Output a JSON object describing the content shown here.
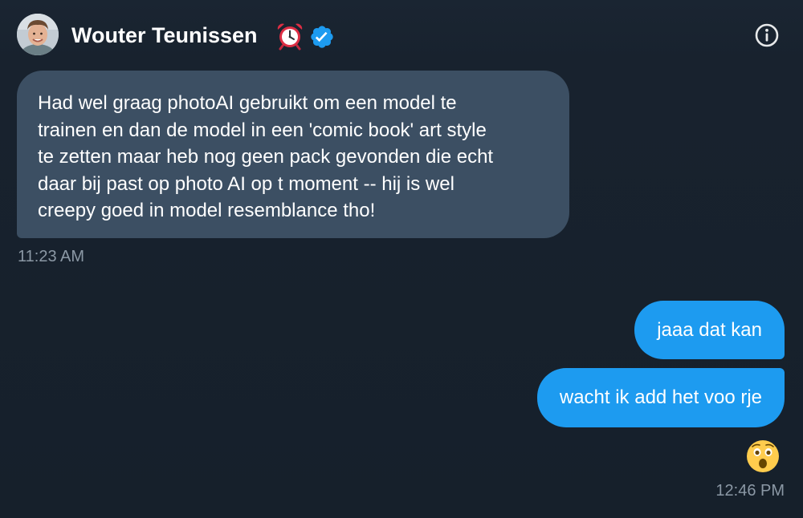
{
  "header": {
    "contact_name": "Wouter Teunissen",
    "icons": [
      "avatar",
      "alarm-clock-emoji",
      "verified-badge-icon",
      "info-icon"
    ],
    "verified_color": "#1d9bf0"
  },
  "messages": [
    {
      "direction": "incoming",
      "text": "Had wel graag photoAI gebruikt om een model te trainen en dan de model in een 'comic book' art style te zetten maar heb nog geen pack gevonden die echt daar bij past op photo AI op t moment -- hij is wel creepy goed in model resemblance tho!",
      "lines": [
        "Had wel graag photoAI gebruikt om een model te",
        "trainen en dan de model in een 'comic book' art style",
        "te zetten maar heb nog geen pack gevonden die echt",
        "daar bij past op photo AI op t moment -- hij is wel",
        "creepy goed in model resemblance tho!"
      ],
      "time": "11:23 AM",
      "bubble_color": "#3c4f63"
    },
    {
      "direction": "outgoing",
      "text": "jaaa dat kan",
      "bubble_color": "#1d9bf0"
    },
    {
      "direction": "outgoing",
      "text": "wacht ik add het voo rje",
      "reaction": "astonished-face-emoji",
      "time": "12:46 PM",
      "bubble_color": "#1d9bf0"
    }
  ],
  "colors": {
    "background": "#15202b",
    "text": "#ffffff",
    "timestamp": "#8b98a5"
  }
}
